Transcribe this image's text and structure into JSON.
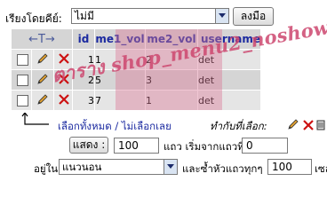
{
  "sort": {
    "label": "เรียงโดยคีย์:",
    "value": "ไม่มี",
    "go_label": "ลงมือ"
  },
  "table": {
    "arrows": "←T→",
    "headers": [
      "id",
      "me1_vol",
      "me2_vol",
      "username"
    ],
    "rows": [
      {
        "id": "1",
        "me1_vol": "1",
        "me2_vol": "2",
        "username": "det"
      },
      {
        "id": "2",
        "me1_vol": "5",
        "me2_vol": "3",
        "username": "det"
      },
      {
        "id": "3",
        "me1_vol": "7",
        "me2_vol": "1",
        "username": "det"
      }
    ]
  },
  "watermark": "ตาราง shop_menu2_noshow",
  "footer": {
    "check_all": "เลือกทั้งหมด",
    "separator": " / ",
    "uncheck_all": "ไม่เลือกเลย",
    "with_selected": "ทำกับที่เลือก:"
  },
  "nav": {
    "show_label": "แสดง :",
    "count": "100",
    "rows_from": "แถว เริ่มจากแถวที่",
    "start": "0",
    "in_label": "อยู่ใน",
    "mode": "แนวนอน",
    "repeat_label": "และซ้ำหัวแถวทุกๆ",
    "repeat": "100",
    "cells_label": "เซล"
  },
  "colors": {
    "header_text": "#1b2aa0",
    "delete_x": "#cc1111",
    "watermark": "#cd466e",
    "overlay": "#dc7896"
  },
  "icons": [
    "pencil-icon",
    "delete-x-icon",
    "bin-icon"
  ]
}
